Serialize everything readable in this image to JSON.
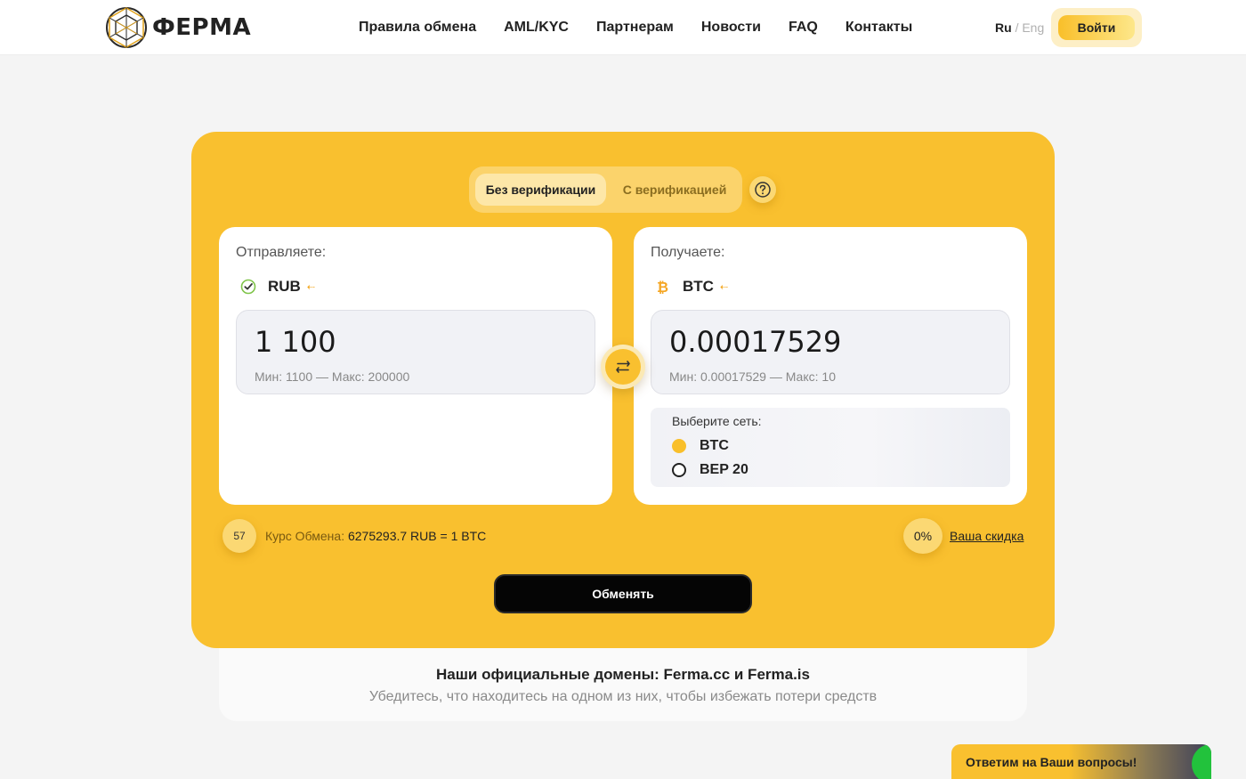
{
  "header": {
    "brand": "ФЕРМА",
    "nav": [
      "Правила обмена",
      "AML/KYC",
      "Партнерам",
      "Новости",
      "FAQ",
      "Контакты"
    ],
    "lang_active": "Ru",
    "lang_separator": "/",
    "lang_inactive": "Eng",
    "login_label": "Войти"
  },
  "exchange": {
    "toggle": {
      "active": "Без верификации",
      "inactive": "С верификацией"
    },
    "send": {
      "label": "Отправляете:",
      "currency": "RUB",
      "amount": "1 100",
      "limits": "Мин: 1100 — Макс: 200000"
    },
    "receive": {
      "label": "Получаете:",
      "currency": "BTC",
      "amount": "0.00017529",
      "limits": "Мин: 0.00017529 — Макс: 10",
      "network_title": "Выберите сеть:",
      "networks": [
        {
          "label": "BTC",
          "selected": true
        },
        {
          "label": "BEP 20",
          "selected": false
        }
      ]
    },
    "timer": "57",
    "rate_label": "Курс Обмена:",
    "rate_value": "6275293.7 RUB = 1 BTC",
    "discount": "0%",
    "discount_link": "Ваша скидка",
    "submit_label": "Обменять"
  },
  "notice": {
    "title": "Наши официальные домены: Ferma.cc и Ferma.is",
    "subtitle": "Убедитесь, что находитесь на одном из них, чтобы избежать потери средств"
  },
  "chat": {
    "label": "Ответим на Ваши вопросы!"
  },
  "colors": {
    "accent": "#f9c02f",
    "dark": "#050505",
    "panel_bg": "#ffffff",
    "input_bg": "#f1f2f6"
  },
  "icons": {
    "help": "question-circle-icon",
    "swap": "swap-arrows-icon",
    "rub": "check-circle-icon",
    "btc": "bitcoin-icon"
  }
}
